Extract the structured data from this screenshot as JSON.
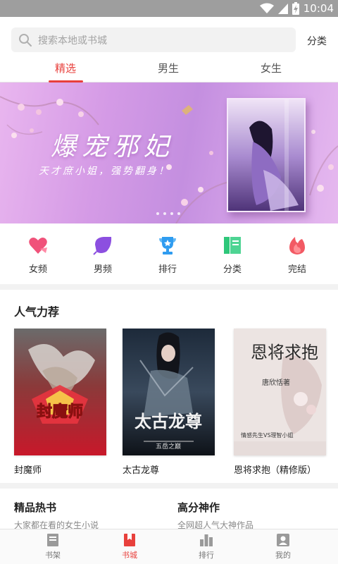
{
  "status_bar": {
    "time": "10:04",
    "icons": [
      "wifi-icon",
      "signal-icon",
      "battery-charging-icon"
    ]
  },
  "header": {
    "search_placeholder": "搜索本地或书城",
    "classify_label": "分类",
    "tabs": [
      {
        "label": "精选",
        "active": true
      },
      {
        "label": "男生",
        "active": false
      },
      {
        "label": "女生",
        "active": false
      }
    ]
  },
  "banner": {
    "title": "爆宠邪妃",
    "subtitle": "天才庶小姐，强势翻身！",
    "page_count": 4
  },
  "categories": [
    {
      "label": "女频",
      "icon": "female-heart-icon",
      "color": "#f0527a"
    },
    {
      "label": "男频",
      "icon": "male-leaf-icon",
      "color": "#8c4fe0"
    },
    {
      "label": "排行",
      "icon": "trophy-icon",
      "color": "#2f9cf0"
    },
    {
      "label": "分类",
      "icon": "category-book-icon",
      "color": "#2ec77a"
    },
    {
      "label": "完结",
      "icon": "flame-icon",
      "color": "#f25a64"
    }
  ],
  "popular": {
    "title": "人气力荐",
    "books": [
      {
        "name": "封魔师",
        "cover_text": "封魔师"
      },
      {
        "name": "太古龙尊",
        "cover_text": "太古龙尊",
        "cover_tag": "五岳之巅"
      },
      {
        "name": "恩将求抱（精修版）",
        "cover_text": "恩将求抱",
        "cover_author": "唐欣恬著",
        "cover_tag": "情感先生VS理智小姐"
      }
    ]
  },
  "sections": [
    {
      "title": "精品热书",
      "desc": "大家都在看的女生小说"
    },
    {
      "title": "高分神作",
      "desc": "全网超人气大神作品"
    }
  ],
  "bottom_nav": [
    {
      "label": "书架",
      "icon": "bookshelf-icon",
      "active": false
    },
    {
      "label": "书城",
      "icon": "bookstore-icon",
      "active": true
    },
    {
      "label": "排行",
      "icon": "ranking-icon",
      "active": false
    },
    {
      "label": "我的",
      "icon": "profile-icon",
      "active": false
    }
  ],
  "colors": {
    "accent": "#e8403c",
    "status_bar": "#9e9e9e"
  }
}
